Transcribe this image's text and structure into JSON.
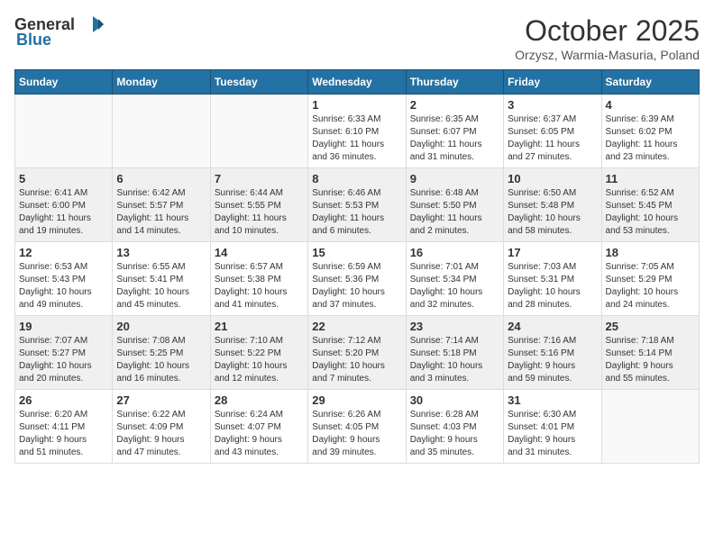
{
  "header": {
    "logo_general": "General",
    "logo_blue": "Blue",
    "month_title": "October 2025",
    "location": "Orzysz, Warmia-Masuria, Poland"
  },
  "days_of_week": [
    "Sunday",
    "Monday",
    "Tuesday",
    "Wednesday",
    "Thursday",
    "Friday",
    "Saturday"
  ],
  "weeks": [
    [
      {
        "day": "",
        "info": ""
      },
      {
        "day": "",
        "info": ""
      },
      {
        "day": "",
        "info": ""
      },
      {
        "day": "1",
        "info": "Sunrise: 6:33 AM\nSunset: 6:10 PM\nDaylight: 11 hours\nand 36 minutes."
      },
      {
        "day": "2",
        "info": "Sunrise: 6:35 AM\nSunset: 6:07 PM\nDaylight: 11 hours\nand 31 minutes."
      },
      {
        "day": "3",
        "info": "Sunrise: 6:37 AM\nSunset: 6:05 PM\nDaylight: 11 hours\nand 27 minutes."
      },
      {
        "day": "4",
        "info": "Sunrise: 6:39 AM\nSunset: 6:02 PM\nDaylight: 11 hours\nand 23 minutes."
      }
    ],
    [
      {
        "day": "5",
        "info": "Sunrise: 6:41 AM\nSunset: 6:00 PM\nDaylight: 11 hours\nand 19 minutes."
      },
      {
        "day": "6",
        "info": "Sunrise: 6:42 AM\nSunset: 5:57 PM\nDaylight: 11 hours\nand 14 minutes."
      },
      {
        "day": "7",
        "info": "Sunrise: 6:44 AM\nSunset: 5:55 PM\nDaylight: 11 hours\nand 10 minutes."
      },
      {
        "day": "8",
        "info": "Sunrise: 6:46 AM\nSunset: 5:53 PM\nDaylight: 11 hours\nand 6 minutes."
      },
      {
        "day": "9",
        "info": "Sunrise: 6:48 AM\nSunset: 5:50 PM\nDaylight: 11 hours\nand 2 minutes."
      },
      {
        "day": "10",
        "info": "Sunrise: 6:50 AM\nSunset: 5:48 PM\nDaylight: 10 hours\nand 58 minutes."
      },
      {
        "day": "11",
        "info": "Sunrise: 6:52 AM\nSunset: 5:45 PM\nDaylight: 10 hours\nand 53 minutes."
      }
    ],
    [
      {
        "day": "12",
        "info": "Sunrise: 6:53 AM\nSunset: 5:43 PM\nDaylight: 10 hours\nand 49 minutes."
      },
      {
        "day": "13",
        "info": "Sunrise: 6:55 AM\nSunset: 5:41 PM\nDaylight: 10 hours\nand 45 minutes."
      },
      {
        "day": "14",
        "info": "Sunrise: 6:57 AM\nSunset: 5:38 PM\nDaylight: 10 hours\nand 41 minutes."
      },
      {
        "day": "15",
        "info": "Sunrise: 6:59 AM\nSunset: 5:36 PM\nDaylight: 10 hours\nand 37 minutes."
      },
      {
        "day": "16",
        "info": "Sunrise: 7:01 AM\nSunset: 5:34 PM\nDaylight: 10 hours\nand 32 minutes."
      },
      {
        "day": "17",
        "info": "Sunrise: 7:03 AM\nSunset: 5:31 PM\nDaylight: 10 hours\nand 28 minutes."
      },
      {
        "day": "18",
        "info": "Sunrise: 7:05 AM\nSunset: 5:29 PM\nDaylight: 10 hours\nand 24 minutes."
      }
    ],
    [
      {
        "day": "19",
        "info": "Sunrise: 7:07 AM\nSunset: 5:27 PM\nDaylight: 10 hours\nand 20 minutes."
      },
      {
        "day": "20",
        "info": "Sunrise: 7:08 AM\nSunset: 5:25 PM\nDaylight: 10 hours\nand 16 minutes."
      },
      {
        "day": "21",
        "info": "Sunrise: 7:10 AM\nSunset: 5:22 PM\nDaylight: 10 hours\nand 12 minutes."
      },
      {
        "day": "22",
        "info": "Sunrise: 7:12 AM\nSunset: 5:20 PM\nDaylight: 10 hours\nand 7 minutes."
      },
      {
        "day": "23",
        "info": "Sunrise: 7:14 AM\nSunset: 5:18 PM\nDaylight: 10 hours\nand 3 minutes."
      },
      {
        "day": "24",
        "info": "Sunrise: 7:16 AM\nSunset: 5:16 PM\nDaylight: 9 hours\nand 59 minutes."
      },
      {
        "day": "25",
        "info": "Sunrise: 7:18 AM\nSunset: 5:14 PM\nDaylight: 9 hours\nand 55 minutes."
      }
    ],
    [
      {
        "day": "26",
        "info": "Sunrise: 6:20 AM\nSunset: 4:11 PM\nDaylight: 9 hours\nand 51 minutes."
      },
      {
        "day": "27",
        "info": "Sunrise: 6:22 AM\nSunset: 4:09 PM\nDaylight: 9 hours\nand 47 minutes."
      },
      {
        "day": "28",
        "info": "Sunrise: 6:24 AM\nSunset: 4:07 PM\nDaylight: 9 hours\nand 43 minutes."
      },
      {
        "day": "29",
        "info": "Sunrise: 6:26 AM\nSunset: 4:05 PM\nDaylight: 9 hours\nand 39 minutes."
      },
      {
        "day": "30",
        "info": "Sunrise: 6:28 AM\nSunset: 4:03 PM\nDaylight: 9 hours\nand 35 minutes."
      },
      {
        "day": "31",
        "info": "Sunrise: 6:30 AM\nSunset: 4:01 PM\nDaylight: 9 hours\nand 31 minutes."
      },
      {
        "day": "",
        "info": ""
      }
    ]
  ]
}
